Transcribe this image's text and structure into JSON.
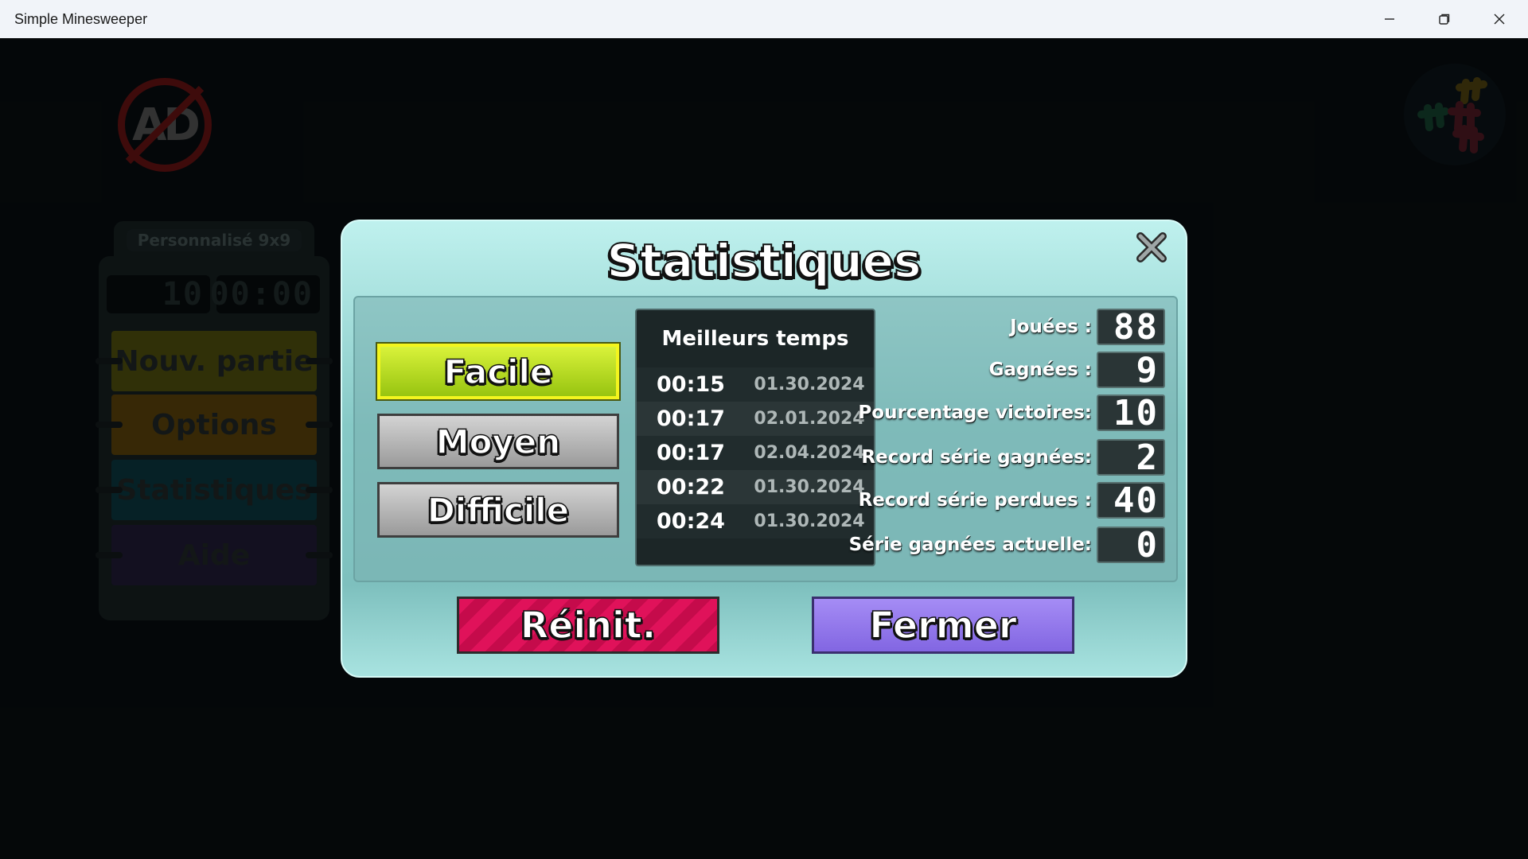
{
  "window": {
    "title": "Simple Minesweeper",
    "controls": {
      "minimize": "minimize-icon",
      "maximize": "restore-icon",
      "close": "close-icon"
    }
  },
  "background": {
    "panel_tab": "Personnalisé 9x9",
    "mine_counter": "10",
    "timer": "00:00",
    "menu": [
      {
        "label": "Nouv. partie",
        "color": "#6b6a12"
      },
      {
        "label": "Options",
        "color": "#7a5a0e"
      },
      {
        "label": "Statistiques",
        "color": "#0e4b54"
      },
      {
        "label": "Aide",
        "color": "#2b2548"
      }
    ],
    "no_ads_text": "AD"
  },
  "dialog": {
    "title": "Statistiques",
    "difficulties": [
      {
        "label": "Facile",
        "selected": true
      },
      {
        "label": "Moyen",
        "selected": false
      },
      {
        "label": "Difficile",
        "selected": false
      }
    ],
    "best_times_header": "Meilleurs temps",
    "best_times": [
      {
        "time": "00:15",
        "date": "01.30.2024"
      },
      {
        "time": "00:17",
        "date": "02.01.2024"
      },
      {
        "time": "00:17",
        "date": "02.04.2024"
      },
      {
        "time": "00:22",
        "date": "01.30.2024"
      },
      {
        "time": "00:24",
        "date": "01.30.2024"
      }
    ],
    "stats": [
      {
        "label": "Jouées :",
        "value": "88"
      },
      {
        "label": "Gagnées :",
        "value": "9"
      },
      {
        "label": "Pourcentage victoires:",
        "value": "10"
      },
      {
        "label": "Record série gagnées:",
        "value": "2"
      },
      {
        "label": "Record série perdues :",
        "value": "40"
      },
      {
        "label": "Série gagnées actuelle:",
        "value": "0"
      }
    ],
    "reset_label": "Réinit.",
    "close_label": "Fermer"
  }
}
